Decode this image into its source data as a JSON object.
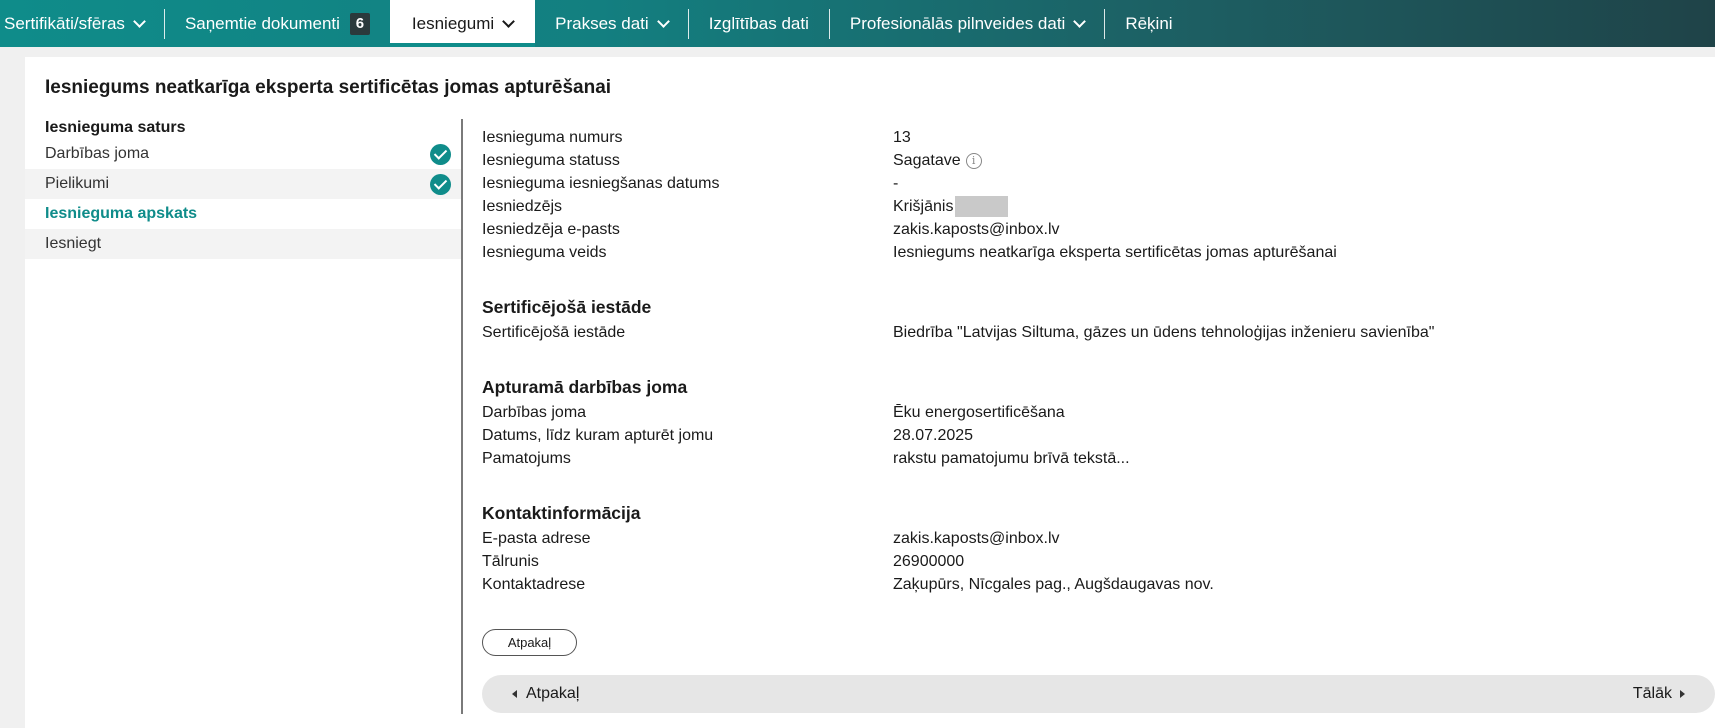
{
  "nav": {
    "items": [
      {
        "label": "Sertifikāti/sfēras"
      },
      {
        "label": "Saņemtie dokumenti",
        "badge": "6"
      },
      {
        "label": "Iesniegumi"
      },
      {
        "label": "Prakses dati"
      },
      {
        "label": "Izglītības dati"
      },
      {
        "label": "Profesionālās pilnveides dati"
      },
      {
        "label": "Rēķini"
      }
    ]
  },
  "page": {
    "title": "Iesniegums neatkarīga eksperta sertificētas jomas apturēšanai"
  },
  "sidebar": {
    "heading": "Iesnieguma saturs",
    "items": [
      {
        "label": "Darbības joma"
      },
      {
        "label": "Pielikumi"
      },
      {
        "label": "Iesnieguma apskats"
      },
      {
        "label": "Iesniegt"
      }
    ]
  },
  "general": {
    "rows": [
      {
        "label": "Iesnieguma numurs",
        "value": "13"
      },
      {
        "label": "Iesnieguma statuss",
        "value": "Sagatave"
      },
      {
        "label": "Iesnieguma iesniegšanas datums",
        "value": "-"
      },
      {
        "label": "Iesniedzējs",
        "value": "Krišjānis"
      },
      {
        "label": "Iesniedzēja e-pasts",
        "value": "zakis.kaposts@inbox.lv"
      },
      {
        "label": "Iesnieguma veids",
        "value": "Iesniegums neatkarīga eksperta sertificētas jomas apturēšanai"
      }
    ]
  },
  "sections": [
    {
      "title": "Sertificējošā iestāde",
      "rows": [
        {
          "label": "Sertificējošā iestāde",
          "value": "Biedrība \"Latvijas Siltuma, gāzes un ūdens tehnoloģijas inženieru savienība\""
        }
      ]
    },
    {
      "title": "Apturamā darbības joma",
      "rows": [
        {
          "label": "Darbības joma",
          "value": "Ēku energosertificēšana"
        },
        {
          "label": "Datums, līdz kuram apturēt jomu",
          "value": "28.07.2025"
        },
        {
          "label": "Pamatojums",
          "value": "rakstu pamatojumu brīvā tekstā..."
        }
      ]
    },
    {
      "title": "Kontaktinformācija",
      "rows": [
        {
          "label": "E-pasta adrese",
          "value": "zakis.kaposts@inbox.lv"
        },
        {
          "label": "Tālrunis",
          "value": "26900000"
        },
        {
          "label": "Kontaktadrese",
          "value": "Zaķupūrs, Nīcgales pag., Augšdaugavas nov."
        }
      ]
    }
  ],
  "buttons": {
    "back": "Atpakaļ"
  },
  "pager": {
    "prev": "Atpakaļ",
    "next": "Tālāk"
  },
  "colors": {
    "accent": "#0f8c8a",
    "nav_dark": "#1f4348"
  }
}
